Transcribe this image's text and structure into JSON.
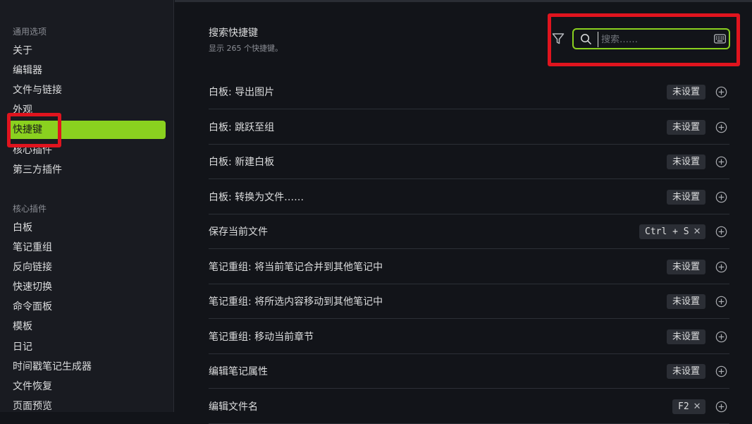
{
  "sidebar": {
    "groups": [
      {
        "title": "通用选项",
        "items": [
          "关于",
          "编辑器",
          "文件与链接",
          "外观",
          "快捷键",
          "核心插件",
          "第三方插件"
        ]
      },
      {
        "title": "核心插件",
        "items": [
          "白板",
          "笔记重组",
          "反向链接",
          "快速切换",
          "命令面板",
          "模板",
          "日记",
          "时间戳笔记生成器",
          "文件恢复",
          "页面预览"
        ]
      }
    ],
    "active_item": "快捷键"
  },
  "header": {
    "title": "搜索快捷键",
    "subtitle": "显示 265 个快捷键。"
  },
  "search": {
    "placeholder": "搜索……",
    "value": ""
  },
  "hotkeys": [
    {
      "label": "白板: 导出图片",
      "hotkey": "未设置",
      "set": false
    },
    {
      "label": "白板: 跳跃至组",
      "hotkey": "未设置",
      "set": false
    },
    {
      "label": "白板: 新建白板",
      "hotkey": "未设置",
      "set": false
    },
    {
      "label": "白板: 转换为文件……",
      "hotkey": "未设置",
      "set": false
    },
    {
      "label": "保存当前文件",
      "hotkey": "Ctrl + S",
      "set": true
    },
    {
      "label": "笔记重组: 将当前笔记合并到其他笔记中",
      "hotkey": "未设置",
      "set": false
    },
    {
      "label": "笔记重组: 将所选内容移动到其他笔记中",
      "hotkey": "未设置",
      "set": false
    },
    {
      "label": "笔记重组: 移动当前章节",
      "hotkey": "未设置",
      "set": false
    },
    {
      "label": "编辑笔记属性",
      "hotkey": "未设置",
      "set": false
    },
    {
      "label": "编辑文件名",
      "hotkey": "F2",
      "set": true
    }
  ],
  "colors": {
    "accent": "#8ad11f",
    "highlight": "#e0141e",
    "background": "#121419",
    "sidebar": "#191b21"
  },
  "icons": {
    "filter": "filter-icon",
    "search": "search-icon",
    "keyboard": "keyboard-icon",
    "add": "plus-circle-icon",
    "remove": "close-icon"
  }
}
